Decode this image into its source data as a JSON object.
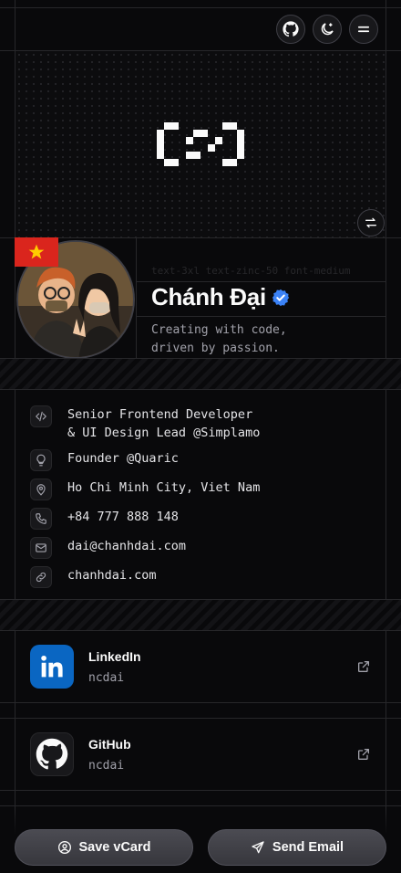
{
  "profile": {
    "class_hint": "text-3xl text-zinc-50 font-medium",
    "name": "Chánh Đại",
    "tagline_line1": "Creating with code,",
    "tagline_line2": "driven by passion."
  },
  "info": [
    {
      "icon": "code-icon",
      "line1": "Senior Frontend Developer",
      "line2": "& UI Design Lead @Simplamo"
    },
    {
      "icon": "lightbulb-icon",
      "line1": "Founder @Quaric"
    },
    {
      "icon": "map-pin-icon",
      "line1": "Ho Chi Minh City, Viet Nam"
    },
    {
      "icon": "phone-icon",
      "line1": "+84 777 888 148"
    },
    {
      "icon": "mail-icon",
      "line1": "dai@chanhdai.com"
    },
    {
      "icon": "link-icon",
      "line1": "chanhdai.com"
    }
  ],
  "social": [
    {
      "title": "LinkedIn",
      "handle": "ncdai",
      "color": "#0a66c2"
    },
    {
      "title": "GitHub",
      "handle": "ncdai",
      "color": "#18181b"
    }
  ],
  "actions": {
    "save_vcard": "Save vCard",
    "send_email": "Send Email"
  },
  "colors": {
    "background": "#09090b",
    "verified": "#3b82f6",
    "flag_red": "#da251d",
    "flag_star": "#ffcd00"
  }
}
